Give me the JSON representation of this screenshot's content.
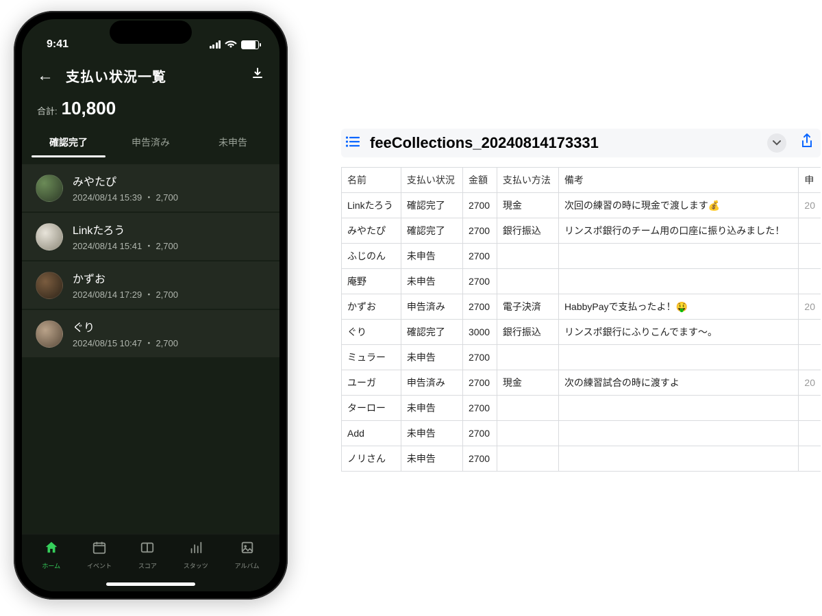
{
  "status": {
    "time": "9:41"
  },
  "header": {
    "title": "支払い状況一覧",
    "total_label": "合計:",
    "total_value": "10,800"
  },
  "tabs": [
    "確認完了",
    "申告済み",
    "未申告"
  ],
  "list": [
    {
      "name": "みやたぴ",
      "date": "2024/08/14 15:39",
      "amount": "2,700"
    },
    {
      "name": "Linkたろう",
      "date": "2024/08/14 15:41",
      "amount": "2,700"
    },
    {
      "name": "かずお",
      "date": "2024/08/14 17:29",
      "amount": "2,700"
    },
    {
      "name": "ぐり",
      "date": "2024/08/15 10:47",
      "amount": "2,700"
    }
  ],
  "tabbar": {
    "home": "ホーム",
    "event": "イベント",
    "score": "スコア",
    "stats": "スタッツ",
    "album": "アルバム"
  },
  "sheet": {
    "filename": "feeCollections_20240814173331",
    "headers": {
      "name": "名前",
      "status": "支払い状況",
      "amount": "金額",
      "method": "支払い方法",
      "note": "備考",
      "extra": "申"
    },
    "rows": [
      {
        "name": "Linkたろう",
        "status": "確認完了",
        "amount": "2700",
        "method": "現金",
        "note": "次回の練習の時に現金で渡します💰",
        "extra": "20"
      },
      {
        "name": "みやたぴ",
        "status": "確認完了",
        "amount": "2700",
        "method": "銀行振込",
        "note": "リンスポ銀行のチーム用の口座に振り込みました！",
        "extra": ""
      },
      {
        "name": "ふじのん",
        "status": "未申告",
        "amount": "2700",
        "method": "",
        "note": "",
        "extra": ""
      },
      {
        "name": "庵野",
        "status": "未申告",
        "amount": "2700",
        "method": "",
        "note": "",
        "extra": ""
      },
      {
        "name": "かずお",
        "status": "申告済み",
        "amount": "2700",
        "method": "電子決済",
        "note": "HabbyPayで支払ったよ！🤑",
        "extra": "20"
      },
      {
        "name": "ぐり",
        "status": "確認完了",
        "amount": "3000",
        "method": "銀行振込",
        "note": "リンスポ銀行にふりこんでます〜。",
        "extra": ""
      },
      {
        "name": "ミュラー",
        "status": "未申告",
        "amount": "2700",
        "method": "",
        "note": "",
        "extra": ""
      },
      {
        "name": "ユーガ",
        "status": "申告済み",
        "amount": "2700",
        "method": "現金",
        "note": "次の練習試合の時に渡すよ",
        "extra": "20"
      },
      {
        "name": "ターロー",
        "status": "未申告",
        "amount": "2700",
        "method": "",
        "note": "",
        "extra": ""
      },
      {
        "name": "Add",
        "status": "未申告",
        "amount": "2700",
        "method": "",
        "note": "",
        "extra": ""
      },
      {
        "name": "ノリさん",
        "status": "未申告",
        "amount": "2700",
        "method": "",
        "note": "",
        "extra": ""
      }
    ]
  }
}
